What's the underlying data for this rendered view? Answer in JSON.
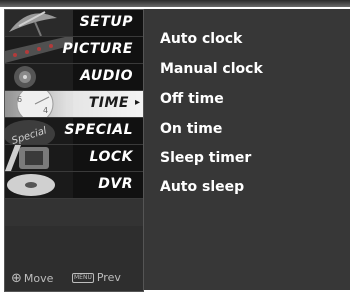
{
  "menu": {
    "items": [
      {
        "label": "SETUP"
      },
      {
        "label": "PICTURE"
      },
      {
        "label": "AUDIO"
      },
      {
        "label": "TIME",
        "selected": true
      },
      {
        "label": "SPECIAL"
      },
      {
        "label": "LOCK"
      },
      {
        "label": "DVR"
      }
    ],
    "selected_arrow": "▸",
    "thumbnail_text_special": "Special"
  },
  "submenu": {
    "items": [
      {
        "label": "Auto clock"
      },
      {
        "label": "Manual clock"
      },
      {
        "label": "Off time"
      },
      {
        "label": "On time"
      },
      {
        "label": "Sleep timer"
      },
      {
        "label": "Auto sleep"
      }
    ]
  },
  "hints": {
    "move_icon": "⊕",
    "move_label": "Move",
    "menu_key": "MENU",
    "prev_label": "Prev"
  },
  "colors": {
    "panel_bg": "#373737",
    "item_bg": "#111111",
    "selected_highlight": "#e4e4e4",
    "text": "#ffffff"
  }
}
